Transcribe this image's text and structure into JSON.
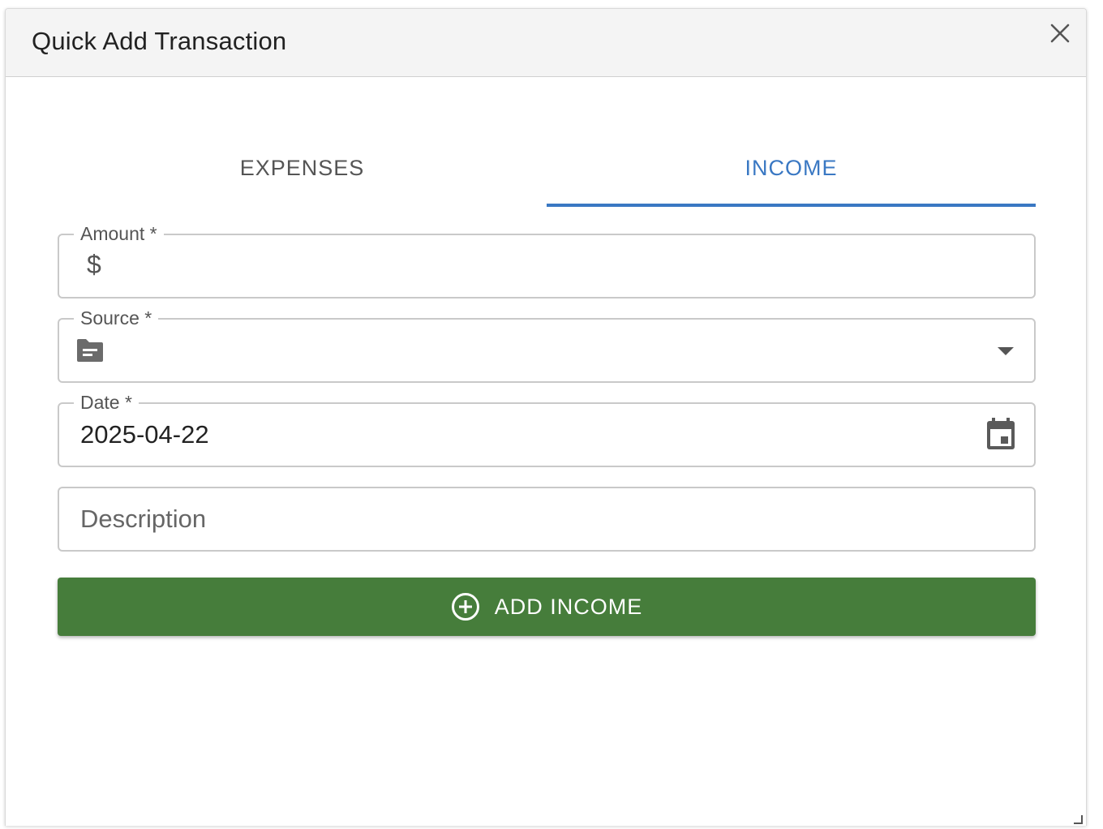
{
  "dialog": {
    "title": "Quick Add Transaction",
    "close_icon": "close-icon"
  },
  "tabs": [
    {
      "label": "EXPENSES",
      "selected": false
    },
    {
      "label": "INCOME",
      "selected": true
    }
  ],
  "colors": {
    "accent": "#3a78c3",
    "button_green": "#467d3b"
  },
  "form": {
    "amount": {
      "label": "Amount *",
      "prefix": "$",
      "value": ""
    },
    "source": {
      "label": "Source *",
      "icon": "folder-icon",
      "value": "",
      "dropdown_icon": "arrow-drop-down-icon"
    },
    "date": {
      "label": "Date *",
      "value": "2025-04-22",
      "icon": "calendar-icon"
    },
    "description": {
      "placeholder": "Description",
      "value": ""
    }
  },
  "submit": {
    "label": "ADD INCOME",
    "icon": "add-circle-icon"
  }
}
